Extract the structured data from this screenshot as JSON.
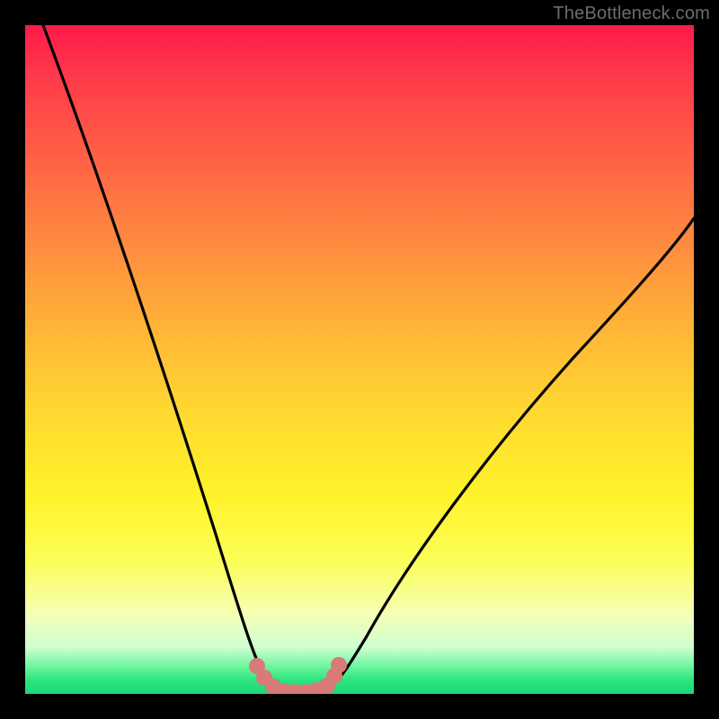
{
  "watermark": "TheBottleneck.com",
  "colors": {
    "background": "#000000",
    "curve": "#000000",
    "dot_fill": "#d87b78",
    "gradient_top": "#ff1a49",
    "gradient_bottom": "#1fd877"
  },
  "chart_data": {
    "type": "line",
    "title": "",
    "xlabel": "",
    "ylabel": "",
    "xlim": [
      0,
      100
    ],
    "ylim": [
      0,
      100
    ],
    "grid": false,
    "legend": false,
    "note": "Axes and ticks are not visible; x and y are normalized 0–100 reading left-to-right and bottom-to-top. The black curve is a V-shaped bottleneck profile with a flat minimum near y≈0 over roughly x≈36–44. Pink dots highlight the flat-bottom region.",
    "series": [
      {
        "name": "bottleneck-curve",
        "x": [
          3,
          6,
          10,
          14,
          18,
          22,
          26,
          30,
          33,
          36,
          38,
          40,
          42,
          44,
          46,
          50,
          56,
          62,
          68,
          74,
          80,
          86,
          92,
          98
        ],
        "y": [
          100,
          90,
          78,
          66,
          55,
          44,
          34,
          24,
          15,
          6,
          2,
          1,
          1,
          2,
          5,
          10,
          18,
          26,
          33,
          40,
          46,
          52,
          57,
          62
        ]
      }
    ],
    "highlight_points": {
      "name": "flat-bottom-dots",
      "x": [
        34.5,
        36.0,
        37.5,
        39.0,
        40.5,
        42.0,
        43.5,
        45.0,
        46.2
      ],
      "y": [
        4.0,
        2.0,
        1.0,
        0.8,
        0.8,
        0.8,
        1.0,
        2.0,
        5.0
      ]
    }
  }
}
